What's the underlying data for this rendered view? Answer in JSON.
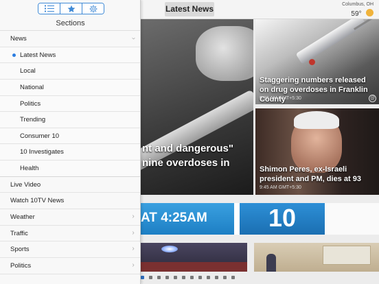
{
  "header": {
    "title": "Latest News",
    "weather": {
      "location": "Columbus, OH",
      "temp": "59°"
    }
  },
  "drawer": {
    "tabs": [
      {
        "icon": "list-icon",
        "active": true
      },
      {
        "icon": "star-icon",
        "active": false
      },
      {
        "icon": "gear-icon",
        "active": false
      }
    ],
    "title": "Sections",
    "items": [
      {
        "label": "News",
        "level": 0,
        "chevron": "down"
      },
      {
        "label": "Latest News",
        "level": 1,
        "selected": true
      },
      {
        "label": "Local",
        "level": 1
      },
      {
        "label": "National",
        "level": 1
      },
      {
        "label": "Politics",
        "level": 1
      },
      {
        "label": "Trending",
        "level": 1
      },
      {
        "label": "Consumer 10",
        "level": 1
      },
      {
        "label": "10 Investigates",
        "level": 1
      },
      {
        "label": "Health",
        "level": 1
      },
      {
        "label": "Live Video",
        "level": 0
      },
      {
        "label": "Watch 10TV News",
        "level": 0
      },
      {
        "label": "Weather",
        "level": 0,
        "chevron": "right"
      },
      {
        "label": "Traffic",
        "level": 0,
        "chevron": "right"
      },
      {
        "label": "Sports",
        "level": 0,
        "chevron": "right"
      },
      {
        "label": "Politics",
        "level": 0,
        "chevron": "right"
      }
    ]
  },
  "main": {
    "lead_story": {
      "headline_line1": "nt and dangerous\"",
      "headline_line2": "nine overdoses in"
    },
    "tiles": [
      {
        "headline": "Staggering numbers released on drug overdoses in Franklin County",
        "time": "9:36 AM GMT+5:30",
        "share_icon": "share-icon"
      },
      {
        "headline": "Shimon Peres, ex-Israeli president and PM, dies at 93",
        "time": "9:45 AM GMT+5:30"
      }
    ],
    "banner": {
      "left_text": "AT 4:25AM",
      "logo_text": "10"
    },
    "pager": {
      "count": 12,
      "current": 0
    }
  }
}
